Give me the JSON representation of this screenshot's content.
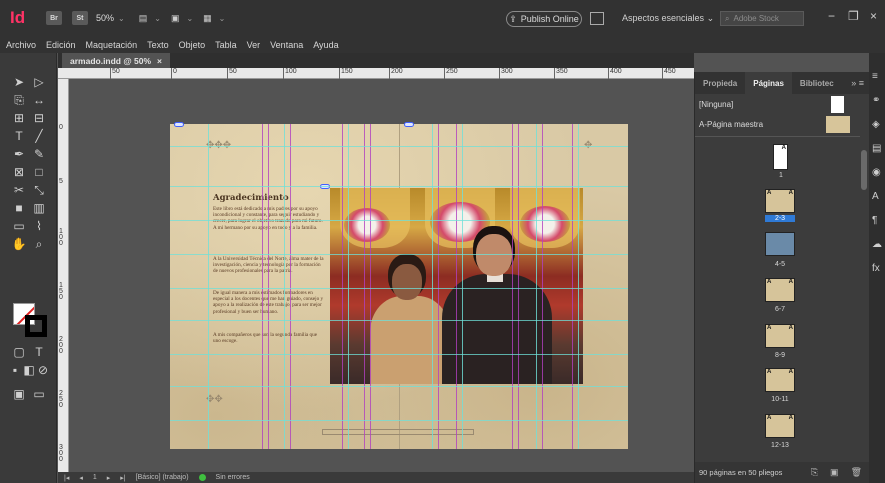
{
  "app": {
    "logo": "Id",
    "bridge": "Br",
    "stock": "St",
    "zoom": "50%",
    "publish_label": "Publish Online",
    "workspace": "Aspectos esenciales",
    "search_placeholder": "Adobe Stock"
  },
  "menu": [
    "Archivo",
    "Edición",
    "Maquetación",
    "Texto",
    "Objeto",
    "Tabla",
    "Ver",
    "Ventana",
    "Ayuda"
  ],
  "document_tab": {
    "title": "armado.indd @ 50%",
    "close": "×"
  },
  "ruler": [
    "50",
    "0",
    "50",
    "100",
    "150",
    "200",
    "250",
    "300",
    "350",
    "400",
    "450"
  ],
  "ruler_v": [
    "0",
    "5",
    "1 0 0",
    "1 5 0",
    "2 0 0",
    "2 5 0",
    "3 0 0"
  ],
  "page_content": {
    "heading": "Agradecimiento",
    "paragraphs": [
      "Este libro está dedicado a mis padres por su apoyo incondicional y constante, para seguir estudiando y crecer, para lograr el objetivo trazado para mi futuro. A mi hermano por su apoyo en todo y a la familia.",
      "A la Universidad Técnica del Norte, alma mater de la investigación, ciencia y tecnología por la formación de nuevos profesionales para la patria.",
      "De igual manera a mis estimados formadores en especial a los docentes que me han guiado, consejo y apoyo a la realización de este trabajo, para ser mejor profesional y buen ser humano.",
      "A mis compañeros que son la segunda familia que uno escoge."
    ]
  },
  "status": {
    "page": "1",
    "master": "[Básico] (trabajo)",
    "errors": "Sin errores"
  },
  "panel": {
    "tabs": [
      "Propieda",
      "Páginas",
      "Bibliotec"
    ],
    "active_tab": "Páginas",
    "masters": [
      "[Ninguna]",
      "A-Página maestra"
    ],
    "pages": [
      "1",
      "2-3",
      "4-5",
      "6-7",
      "8-9",
      "10-11",
      "12-13"
    ],
    "selected_page": "2-3",
    "footer": "90 páginas en 50 pliegos"
  },
  "colors": {
    "accent": "#2f7ad6",
    "guide": "#6fe0d8",
    "column": "#b040c0",
    "paper": "#d9c9a5"
  }
}
